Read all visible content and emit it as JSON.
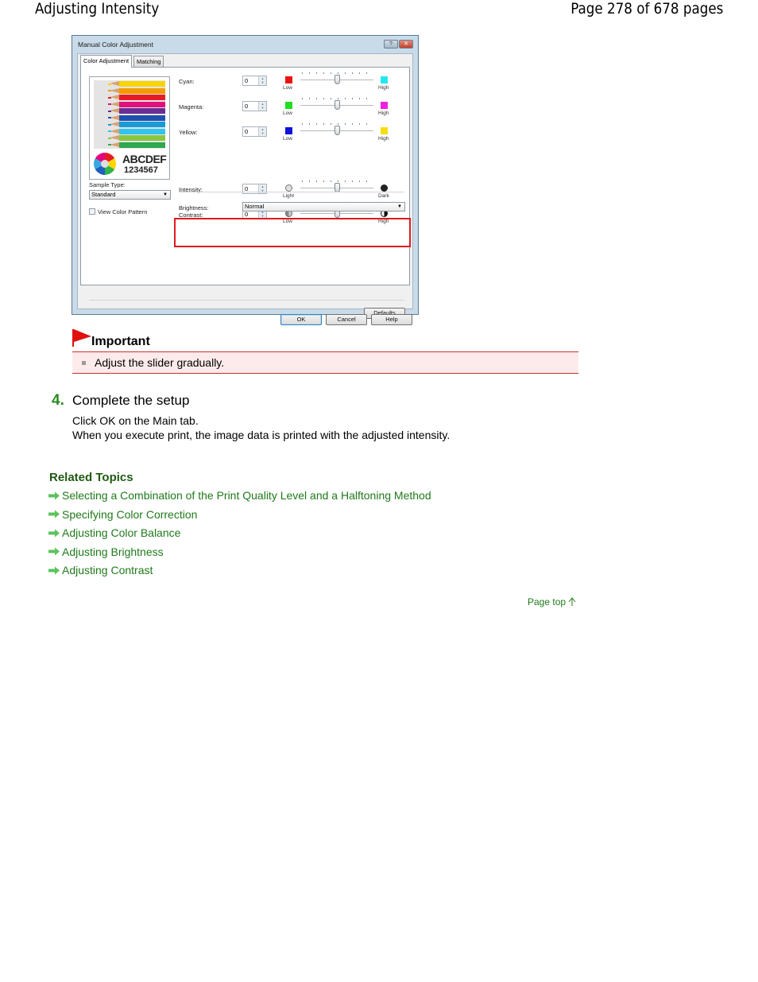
{
  "header": {
    "title": "Adjusting Intensity",
    "page_info": "Page 278 of 678 pages"
  },
  "dialog": {
    "title": "Manual Color Adjustment",
    "title_buttons": {
      "help": "?",
      "close": "✕"
    },
    "tabs": [
      {
        "label": "Color Adjustment",
        "active": true
      },
      {
        "label": "Matching",
        "active": false
      }
    ],
    "preview": {
      "text_line1": "ABCDEF",
      "text_line2": "1234567"
    },
    "sample_type": {
      "label": "Sample Type:",
      "value": "Standard"
    },
    "view_color_pattern": {
      "label": "View Color Pattern",
      "checked": false
    },
    "sliders": [
      {
        "name": "cyan",
        "label": "Cyan:",
        "value": "0",
        "low_label": "Low",
        "high_label": "High",
        "low_color": "#ee1111",
        "high_color": "#22e6f0",
        "position": 0.5
      },
      {
        "name": "magenta",
        "label": "Magenta:",
        "value": "0",
        "low_label": "Low",
        "high_label": "High",
        "low_color": "#22dd22",
        "high_color": "#ee22dd",
        "position": 0.5
      },
      {
        "name": "yellow",
        "label": "Yellow:",
        "value": "0",
        "low_label": "Low",
        "high_label": "High",
        "low_color": "#1111dd",
        "high_color": "#f5dd11",
        "position": 0.5
      }
    ],
    "brightness": {
      "label": "Brightness:",
      "value": "Normal"
    },
    "intensity": {
      "label": "Intensity:",
      "value": "0",
      "low_label": "Light",
      "high_label": "Dark",
      "position": 0.5,
      "highlight_color": "#e0191e"
    },
    "contrast": {
      "label": "Contrast:",
      "value": "0",
      "low_label": "Low",
      "high_label": "High",
      "position": 0.5
    },
    "buttons": {
      "defaults": "Defaults",
      "ok": "OK",
      "cancel": "Cancel",
      "help": "Help"
    }
  },
  "important": {
    "title": "Important",
    "items": [
      "Adjust the slider gradually."
    ],
    "accent_color": "#c9302c"
  },
  "step": {
    "number": "4.",
    "title": "Complete the setup",
    "lines": [
      "Click OK on the Main tab.",
      "When you execute print, the image data is printed with the adjusted intensity."
    ]
  },
  "related": {
    "title": "Related Topics",
    "links": [
      "Selecting a Combination of the Print Quality Level and a Halftoning Method",
      "Specifying Color Correction",
      "Adjusting Color Balance",
      "Adjusting Brightness",
      "Adjusting Contrast"
    ]
  },
  "page_top": {
    "label": "Page top",
    "icon": "arrow-up-icon"
  }
}
